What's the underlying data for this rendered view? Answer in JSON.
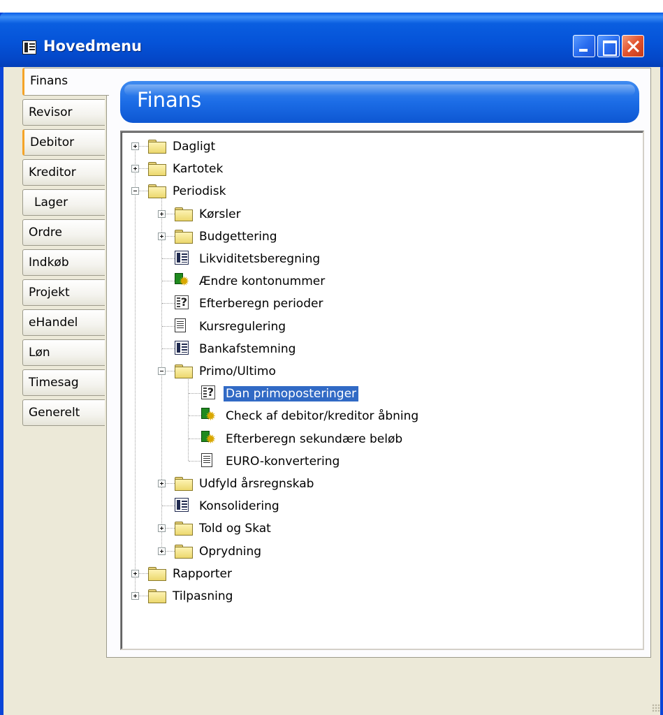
{
  "window": {
    "title": "Hovedmenu"
  },
  "tabs": [
    {
      "label": "Finans",
      "active": true
    },
    {
      "label": "Revisor"
    },
    {
      "label": "Debitor"
    },
    {
      "label": "Kreditor"
    },
    {
      "label": "Lager"
    },
    {
      "label": "Ordre"
    },
    {
      "label": "Indkøb"
    },
    {
      "label": "Projekt"
    },
    {
      "label": "eHandel"
    },
    {
      "label": "Løn"
    },
    {
      "label": "Timesag"
    },
    {
      "label": "Generelt"
    }
  ],
  "header": {
    "title": "Finans"
  },
  "tree": [
    {
      "label": "Dagligt",
      "icon": "folder-icon",
      "expander": "plus",
      "level": 0
    },
    {
      "label": "Kartotek",
      "icon": "folder-icon",
      "expander": "plus",
      "level": 0
    },
    {
      "label": "Periodisk",
      "icon": "folder-icon",
      "expander": "minus",
      "level": 0
    },
    {
      "label": "Kørsler",
      "icon": "folder-icon",
      "expander": "plus",
      "level": 1
    },
    {
      "label": "Budgettering",
      "icon": "folder-icon",
      "expander": "plus",
      "level": 1
    },
    {
      "label": "Likviditetsberegning",
      "icon": "form-icon",
      "level": 1
    },
    {
      "label": "Ændre kontonummer",
      "icon": "macro-icon",
      "level": 1
    },
    {
      "label": "Efterberegn perioder",
      "icon": "query-icon",
      "level": 1
    },
    {
      "label": "Kursregulering",
      "icon": "report-icon",
      "level": 1
    },
    {
      "label": "Bankafstemning",
      "icon": "form-icon",
      "level": 1
    },
    {
      "label": "Primo/Ultimo",
      "icon": "folder-icon",
      "expander": "minus",
      "level": 1
    },
    {
      "label": "Dan primoposteringer",
      "icon": "query-icon",
      "level": 2,
      "selected": true
    },
    {
      "label": "Check af debitor/kreditor åbning",
      "icon": "macro-icon",
      "level": 2
    },
    {
      "label": "Efterberegn sekundære beløb",
      "icon": "macro-icon",
      "level": 2
    },
    {
      "label": "EURO-konvertering",
      "icon": "report-icon",
      "level": 2
    },
    {
      "label": "Udfyld årsregnskab",
      "icon": "folder-icon",
      "expander": "plus",
      "level": 1
    },
    {
      "label": "Konsolidering",
      "icon": "form-icon",
      "level": 1
    },
    {
      "label": "Told og Skat",
      "icon": "folder-icon",
      "expander": "plus",
      "level": 1
    },
    {
      "label": "Oprydning",
      "icon": "folder-icon",
      "expander": "plus",
      "level": 1
    },
    {
      "label": "Rapporter",
      "icon": "folder-icon",
      "expander": "plus",
      "level": 0
    },
    {
      "label": "Tilpasning",
      "icon": "folder-icon",
      "expander": "plus",
      "level": 0
    }
  ],
  "colors": {
    "titlebar": "#0553d8",
    "header_bar": "#1c6de6",
    "selection": "#316ac5",
    "tab_accent": "#f5a428"
  }
}
